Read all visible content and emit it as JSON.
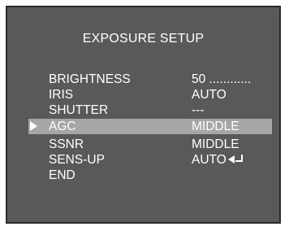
{
  "menu": {
    "title": "EXPOSURE SETUP",
    "selected_index": 3,
    "items": [
      {
        "label": "BRIGHTNESS",
        "value": "50 ............"
      },
      {
        "label": "IRIS",
        "value": "AUTO"
      },
      {
        "label": "SHUTTER",
        "value": "---"
      },
      {
        "label": "AGC",
        "value": "MIDDLE"
      },
      {
        "label": "SSNR",
        "value": "MIDDLE"
      },
      {
        "label": "SENS-UP",
        "value": "AUTO",
        "icon": "enter-submenu-icon"
      },
      {
        "label": "END",
        "value": ""
      }
    ]
  },
  "colors": {
    "background": "#595959",
    "frame_border": "#2a2a2a",
    "highlight": "#a6a6a6",
    "text": "#ffffff"
  }
}
